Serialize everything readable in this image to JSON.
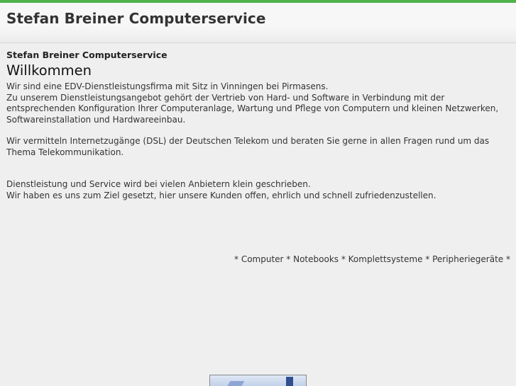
{
  "header": {
    "site_title": "Stefan Breiner Computerservice"
  },
  "content": {
    "subtitle": "Stefan Breiner Computerservice",
    "heading": "Willkommen",
    "intro_line_1": "Wir sind eine EDV-Dienstleistungsfirma mit Sitz in Vinningen bei Pirmasens.",
    "intro_line_2": "Zu unserem Dienstleistungsangebot gehört der Vertrieb von Hard- und Software in Verbindung mit der entsprechenden Konfiguration Ihrer Computeranlage, Wartung und Pflege von Computern und kleinen Netzwerken, Softwareinstallation und Hardwareeinbau.",
    "dsl_paragraph": "Wir vermitteln Internetzugänge (DSL) der Deutschen Telekom und beraten Sie gerne in allen Fragen rund um das Thema Telekommunikation.",
    "service_line_1": "Dienstleistung und Service wird bei vielen Anbietern klein geschrieben.",
    "service_line_2": "Wir haben es uns zum Ziel gesetzt, hier unsere Kunden offen, ehrlich und schnell zufriedenzustellen.",
    "products_line": "* Computer * Notebooks * Komplettsysteme * Peripheriegeräte *"
  },
  "colors": {
    "accent_bar": "#4fb34a",
    "background": "#efefef"
  }
}
